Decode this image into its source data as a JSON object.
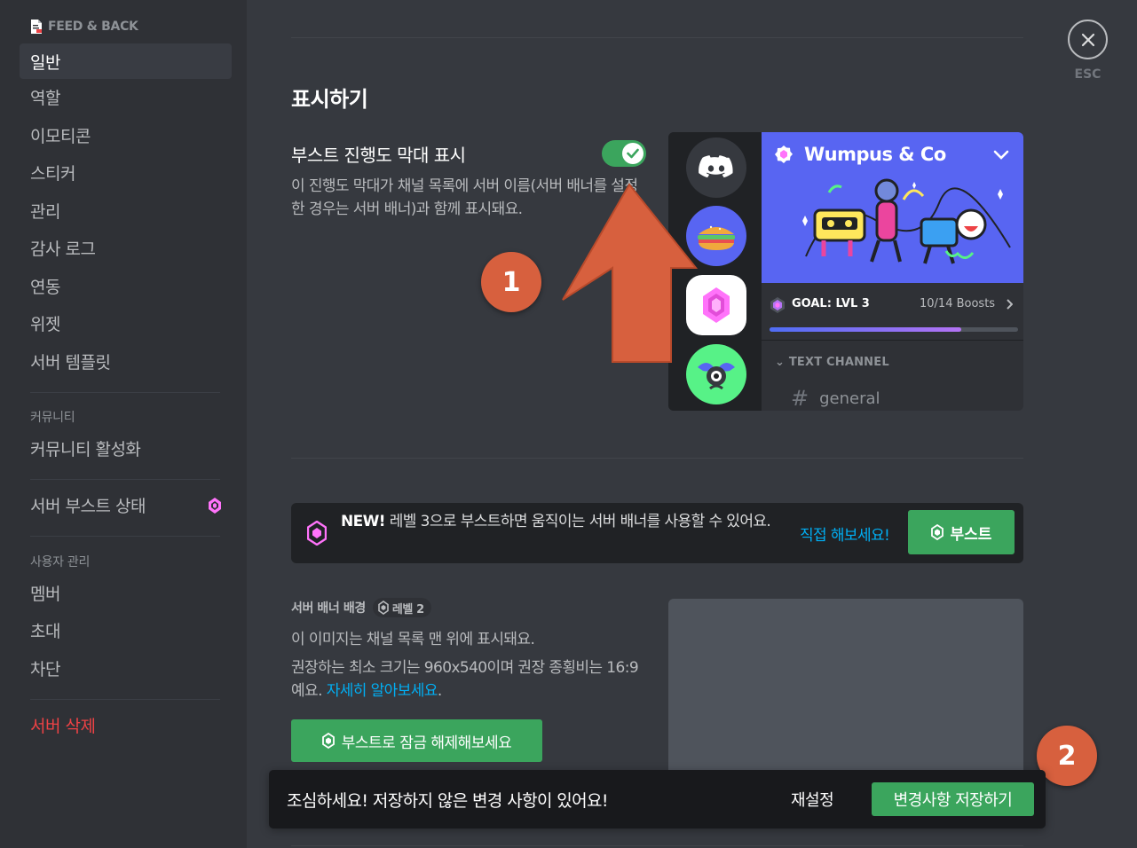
{
  "sidebar": {
    "server_name": "FEED & BACK",
    "items": [
      {
        "label": "일반"
      },
      {
        "label": "역할"
      },
      {
        "label": "이모티콘"
      },
      {
        "label": "스티커"
      },
      {
        "label": "관리"
      },
      {
        "label": "감사 로그"
      },
      {
        "label": "연동"
      },
      {
        "label": "위젯"
      },
      {
        "label": "서버 템플릿"
      }
    ],
    "community_section": "커뮤니티",
    "community_item": "커뮤니티 활성화",
    "boost_status": "서버 부스트 상태",
    "user_mgmt_section": "사용자 관리",
    "user_items": [
      {
        "label": "멤버"
      },
      {
        "label": "초대"
      },
      {
        "label": "차단"
      }
    ],
    "delete_server": "서버 삭제"
  },
  "close": {
    "label": "ESC"
  },
  "display": {
    "title": "표시하기",
    "option_title": "부스트 진행도 막대 표시",
    "option_desc": "이 진행도 막대가 채널 목록에 서버 이름(서버 배너를 설정한 경우는 서버 배너)과 함께 표시돼요.",
    "toggle_on": true
  },
  "preview": {
    "server_name": "Wumpus & Co",
    "goal": "GOAL: LVL 3",
    "boosts": "10/14 Boosts",
    "boost_progress": 0.77,
    "category": "TEXT CHANNEL",
    "channel": "general"
  },
  "markers": {
    "one": "1",
    "two": "2"
  },
  "notice": {
    "new_label": "NEW!",
    "text": " 레벨 3으로 부스트하면 움직이는 서버 배너를 사용할 수 있어요.",
    "link": "직접 해보세요!",
    "button": "부스트"
  },
  "banner_bg": {
    "title": "서버 배너 배경",
    "level": "레벨 2",
    "desc1": "이 이미지는 채널 목록 맨 위에 표시돼요.",
    "desc2": "권장하는 최소 크기는 960x540이며 권장 종횡비는 16:9예요. ",
    "learn_more": "자세히 알아보세요",
    "period": ".",
    "unlock_button": "부스트로 잠금 해제해보세요"
  },
  "savebar": {
    "message": "조심하세요! 저장하지 않은 변경 사항이 있어요!",
    "reset": "재설정",
    "save": "변경사항 저장하기"
  },
  "colors": {
    "background": "#36393f",
    "sidebar": "#2f3136",
    "green": "#3ba55d",
    "blurple": "#5865f2",
    "link": "#00aff4",
    "danger": "#ed4245",
    "marker": "#d7603e",
    "boost_pink": "#ff73fa"
  }
}
